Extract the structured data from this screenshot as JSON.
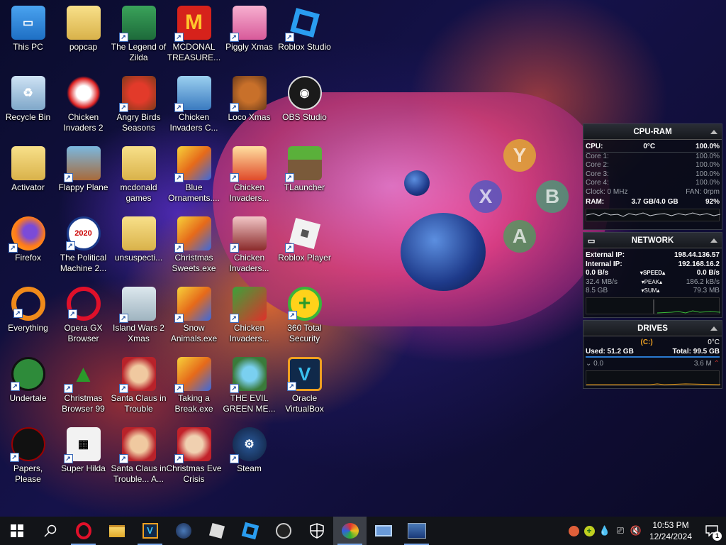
{
  "desktop": {
    "icons": [
      {
        "label": "This PC"
      },
      {
        "label": "Recycle Bin"
      },
      {
        "label": "Activator"
      },
      {
        "label": "Firefox"
      },
      {
        "label": "Everything"
      },
      {
        "label": "Undertale"
      },
      {
        "label": "Papers, Please"
      },
      {
        "label": "popcap"
      },
      {
        "label": "Chicken Invaders 2"
      },
      {
        "label": "Flappy Plane"
      },
      {
        "label": "The Political Machine 2..."
      },
      {
        "label": "Opera GX Browser"
      },
      {
        "label": "Christmas Browser 99"
      },
      {
        "label": "Super Hilda"
      },
      {
        "label": "The Legend of Zilda"
      },
      {
        "label": "Angry Birds Seasons"
      },
      {
        "label": "mcdonald games"
      },
      {
        "label": "unsuspecti..."
      },
      {
        "label": "Island Wars 2 Xmas"
      },
      {
        "label": "Santa Claus in Trouble"
      },
      {
        "label": "Santa Claus in Trouble... A..."
      },
      {
        "label": "MCDONAL TREASURE..."
      },
      {
        "label": "Chicken Invaders C..."
      },
      {
        "label": "Blue Ornaments...."
      },
      {
        "label": "Christmas Sweets.exe"
      },
      {
        "label": "Snow Animals.exe"
      },
      {
        "label": "Taking a Break.exe"
      },
      {
        "label": "Christmas Eve Crisis"
      },
      {
        "label": "Piggly Xmas"
      },
      {
        "label": "Loco Xmas"
      },
      {
        "label": "Chicken Invaders..."
      },
      {
        "label": "Chicken Invaders..."
      },
      {
        "label": "Chicken Invaders..."
      },
      {
        "label": "THE EVIL GREEN ME..."
      },
      {
        "label": "Steam"
      },
      {
        "label": "Roblox Studio"
      },
      {
        "label": "OBS Studio"
      },
      {
        "label": "TLauncher"
      },
      {
        "label": "Roblox Player"
      },
      {
        "label": "360 Total Security"
      },
      {
        "label": "Oracle VirtualBox"
      }
    ]
  },
  "wallpaper": {
    "controller_buttons": [
      "Y",
      "X",
      "B",
      "A"
    ]
  },
  "widgets": {
    "cpu_ram": {
      "title": "CPU-RAM",
      "cpu_label": "CPU:",
      "cpu_temp": "0°C",
      "cpu_pct": "100.0%",
      "cores": [
        {
          "label": "Core 1:",
          "value": "100.0%"
        },
        {
          "label": "Core 2:",
          "value": "100.0%"
        },
        {
          "label": "Core 3:",
          "value": "100.0%"
        },
        {
          "label": "Core 4:",
          "value": "100.0%"
        }
      ],
      "clock_label": "Clock: 0 MHz",
      "fan_label": "FAN: 0rpm",
      "ram_label": "RAM:",
      "ram_value": "3.7 GB/4.0 GB",
      "ram_pct": "92%"
    },
    "network": {
      "title": "NETWORK",
      "external_label": "External IP:",
      "external_ip": "198.44.136.57",
      "internal_label": "Internal IP:",
      "internal_ip": "192.168.16.2",
      "speed_down": "0.0 B/s",
      "speed_label": "SPEED",
      "speed_up": "0.0 B/s",
      "peak_down": "32.4 MB/s",
      "peak_label": "PEAK",
      "peak_up": "186.2 kB/s",
      "sum_down": "8.5 GB",
      "sum_label": "SUM",
      "sum_up": "79.3 MB"
    },
    "drives": {
      "title": "DRIVES",
      "drive_letter": "(C:)",
      "temp": "0°C",
      "used": "Used: 51.2 GB",
      "total": "Total: 99.5 GB",
      "read": "0.0",
      "write": "3.6 M"
    }
  },
  "taskbar": {
    "clock_time": "10:53 PM",
    "clock_date": "12/24/2024",
    "notification_count": "1"
  },
  "colors": {
    "accent": "#f5a623",
    "taskbar": "#121418",
    "underline": "#7aa7e8"
  }
}
